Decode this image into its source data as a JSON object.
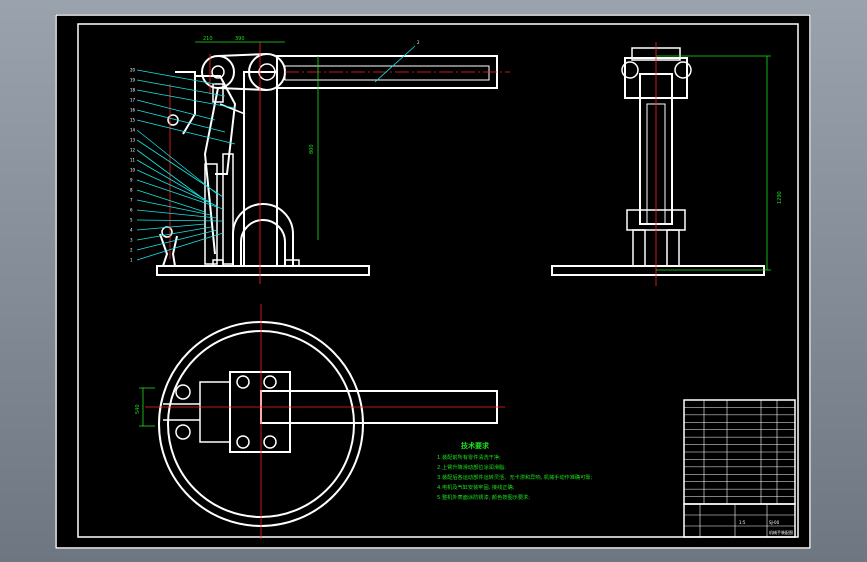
{
  "drawing": {
    "colors": {
      "background": "#000000",
      "outline": "#ffffff",
      "centerline": "#ff2020",
      "leader": "#19e3e3",
      "dimension": "#1ee01e"
    },
    "dimensions": {
      "top_width_a": "210",
      "top_width_b": "390",
      "arm_height": "800",
      "side_height": "1290",
      "plan_width": "540",
      "callout_top": "2"
    },
    "part_numbers_left": [
      "20",
      "19",
      "18",
      "17",
      "16",
      "15",
      "14",
      "13",
      "12",
      "11",
      "10",
      "9",
      "8",
      "7",
      "6",
      "5",
      "4",
      "3",
      "2",
      "1"
    ],
    "tech_requirements": {
      "title": "技术要求",
      "lines": [
        "1.装配前所有零件清洗干净;",
        "2.上臂升降滑动部位涂润滑脂;",
        "3.装配后各运动部件运转灵活、无卡滞和异响, 机械手动作准确可靠;",
        "4.电机及气缸安装牢固, 接线正确;",
        "5.整机外表面涂防锈漆, 颜色按图示要求;"
      ]
    },
    "title_block": {
      "drawing_name": "机械手装配图",
      "code": "SJ-00",
      "scale": "1:5"
    }
  }
}
